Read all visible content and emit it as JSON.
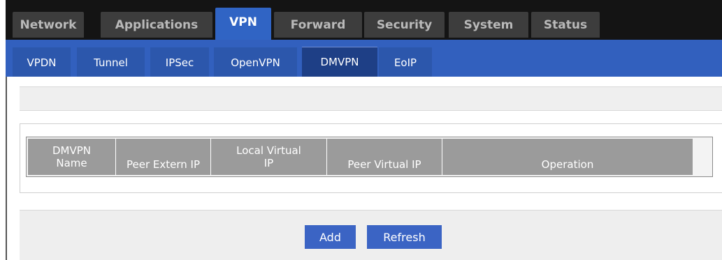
{
  "top_nav": {
    "tabs": [
      {
        "label": "Network",
        "active": false
      },
      {
        "label": "Applications",
        "active": false
      },
      {
        "label": "VPN",
        "active": true
      },
      {
        "label": "Forward",
        "active": false
      },
      {
        "label": "Security",
        "active": false
      },
      {
        "label": "System",
        "active": false
      },
      {
        "label": "Status",
        "active": false
      }
    ]
  },
  "sub_nav": {
    "tabs": [
      {
        "label": "VPDN",
        "active": false
      },
      {
        "label": "Tunnel",
        "active": false
      },
      {
        "label": "IPSec",
        "active": false
      },
      {
        "label": "OpenVPN",
        "active": false
      },
      {
        "label": "DMVPN",
        "active": true
      },
      {
        "label": "EoIP",
        "active": false
      }
    ]
  },
  "table": {
    "columns": [
      {
        "line1": "DMVPN",
        "line2": "Name"
      },
      {
        "line1": "Peer Extern IP",
        "line2": ""
      },
      {
        "line1": "Local Virtual",
        "line2": "IP"
      },
      {
        "line1": "Peer Virtual IP",
        "line2": ""
      },
      {
        "line1": "Operation",
        "line2": ""
      }
    ],
    "rows": []
  },
  "actions": {
    "add_label": "Add",
    "refresh_label": "Refresh"
  },
  "colors": {
    "top_bar": "#141414",
    "top_tab": "#3d3d3d",
    "active_tab": "#3064c4",
    "sub_bar": "#3260be",
    "sub_tab": "#2c57ac",
    "sub_tab_active": "#1e3f86",
    "header_cell": "#9b9b9b",
    "button": "#3b64c4"
  }
}
